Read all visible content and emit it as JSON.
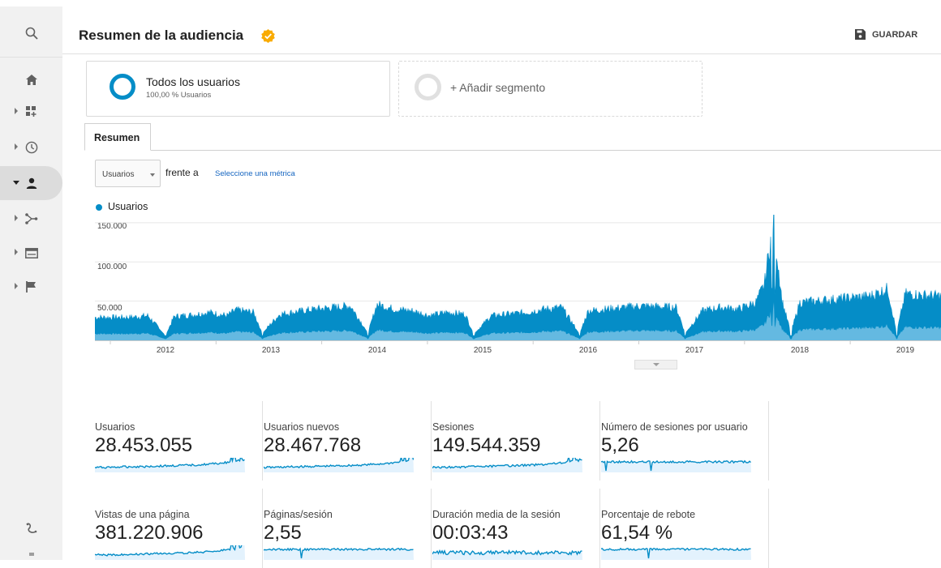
{
  "header": {
    "title": "Resumen de la audiencia",
    "save_label": "GUARDAR"
  },
  "segments": {
    "active_name": "Todos los usuarios",
    "active_pct": "100,00 % Usuarios",
    "add_label": "+ Añadir segmento"
  },
  "tabs": {
    "summary": "Resumen"
  },
  "controls": {
    "metric_value": "Usuarios",
    "vs_label": "frente a",
    "select_metric_link": "Seleccione una métrica"
  },
  "colors": {
    "series": "#058dc7",
    "area": "#b3def5",
    "accent_badge": "#f9ab00"
  },
  "icons": [
    "search-icon",
    "home-icon",
    "dashboard-icon",
    "clock-icon",
    "person-icon",
    "acquisition-icon",
    "behavior-icon",
    "flag-icon",
    "discover-icon",
    "save-icon",
    "verified-icon"
  ],
  "chart_data": {
    "type": "area",
    "series_name": "Usuarios",
    "y_tick_labels": [
      "150.000",
      "100.000",
      "50.000"
    ],
    "y_ticks": [
      150000,
      100000,
      50000
    ],
    "ylim": [
      0,
      155000
    ],
    "x_tick_labels": [
      "2012",
      "2013",
      "2014",
      "2015",
      "2016",
      "2017",
      "2018",
      "2019"
    ],
    "grid": true,
    "legend": "top-left",
    "points": [
      {
        "date": "2011-09",
        "value": 28000
      },
      {
        "date": "2011-11",
        "value": 30000
      },
      {
        "date": "2012-01",
        "value": 6000
      },
      {
        "date": "2012-02",
        "value": 29000
      },
      {
        "date": "2012-04",
        "value": 31000
      },
      {
        "date": "2012-06",
        "value": 34000
      },
      {
        "date": "2012-08",
        "value": 30000
      },
      {
        "date": "2012-09",
        "value": 37000
      },
      {
        "date": "2012-11",
        "value": 34000
      },
      {
        "date": "2012-12",
        "value": 9000
      },
      {
        "date": "2013-02",
        "value": 32000
      },
      {
        "date": "2013-04",
        "value": 35000
      },
      {
        "date": "2013-06",
        "value": 38000
      },
      {
        "date": "2013-08",
        "value": 40000
      },
      {
        "date": "2013-10",
        "value": 42000
      },
      {
        "date": "2013-12",
        "value": 9000
      },
      {
        "date": "2014-01",
        "value": 44000
      },
      {
        "date": "2014-03",
        "value": 38000
      },
      {
        "date": "2014-05",
        "value": 36000
      },
      {
        "date": "2014-07",
        "value": 30000
      },
      {
        "date": "2014-09",
        "value": 34000
      },
      {
        "date": "2014-11",
        "value": 32000
      },
      {
        "date": "2014-12",
        "value": 8000
      },
      {
        "date": "2015-02",
        "value": 30000
      },
      {
        "date": "2015-04",
        "value": 32000
      },
      {
        "date": "2015-06",
        "value": 34000
      },
      {
        "date": "2015-08",
        "value": 38000
      },
      {
        "date": "2015-10",
        "value": 40000
      },
      {
        "date": "2015-12",
        "value": 8000
      },
      {
        "date": "2016-01",
        "value": 36000
      },
      {
        "date": "2016-03",
        "value": 38000
      },
      {
        "date": "2016-05",
        "value": 40000
      },
      {
        "date": "2016-07",
        "value": 42000
      },
      {
        "date": "2016-09",
        "value": 41000
      },
      {
        "date": "2016-11",
        "value": 40000
      },
      {
        "date": "2016-12",
        "value": 9000
      },
      {
        "date": "2017-02",
        "value": 36000
      },
      {
        "date": "2017-04",
        "value": 40000
      },
      {
        "date": "2017-06",
        "value": 38000
      },
      {
        "date": "2017-08",
        "value": 46000
      },
      {
        "date": "2017-09",
        "value": 68000
      },
      {
        "date": "2017-10",
        "value": 148000
      },
      {
        "date": "2017-11",
        "value": 48000
      },
      {
        "date": "2017-12",
        "value": 9000
      },
      {
        "date": "2018-01",
        "value": 46000
      },
      {
        "date": "2018-03",
        "value": 48000
      },
      {
        "date": "2018-05",
        "value": 50000
      },
      {
        "date": "2018-07",
        "value": 52000
      },
      {
        "date": "2018-09",
        "value": 54000
      },
      {
        "date": "2018-11",
        "value": 63000
      },
      {
        "date": "2018-12",
        "value": 9000
      },
      {
        "date": "2019-01",
        "value": 57000
      },
      {
        "date": "2019-03",
        "value": 55000
      },
      {
        "date": "2019-05",
        "value": 54000
      }
    ]
  },
  "metrics": [
    {
      "label": "Usuarios",
      "value": "28.453.055"
    },
    {
      "label": "Usuarios nuevos",
      "value": "28.467.768"
    },
    {
      "label": "Sesiones",
      "value": "149.544.359"
    },
    {
      "label": "Número de sesiones por usuario",
      "value": "5,26"
    },
    {
      "label": "Vistas de una página",
      "value": "381.220.906"
    },
    {
      "label": "Páginas/sesión",
      "value": "2,55"
    },
    {
      "label": "Duración media de la sesión",
      "value": "00:03:43"
    },
    {
      "label": "Porcentaje de rebote",
      "value": "61,54 %"
    }
  ]
}
